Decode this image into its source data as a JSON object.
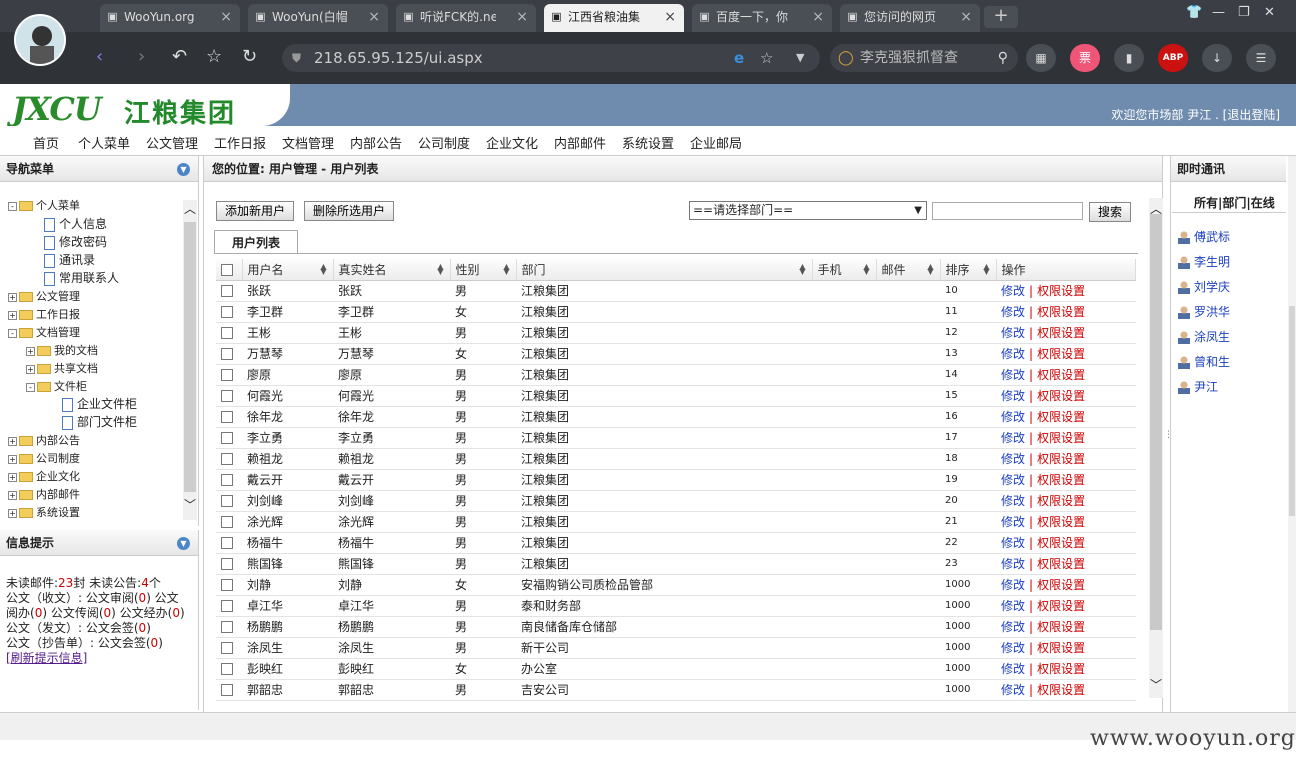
{
  "browser": {
    "tabs": [
      {
        "label": "WooYun.org",
        "active": false
      },
      {
        "label": "WooYun(白帽",
        "active": false
      },
      {
        "label": "听说FCK的.ne",
        "active": false
      },
      {
        "label": "江西省粮油集",
        "active": true
      },
      {
        "label": "百度一下，你",
        "active": false
      },
      {
        "label": "您访问的网页",
        "active": false
      }
    ],
    "url": "218.65.95.125/ui.aspx",
    "search_text": "李克强狠抓督查",
    "newtab_label": "+"
  },
  "header": {
    "logo_en": "JXCU",
    "logo_cn": "江粮集团",
    "welcome": "欢迎您市场部 尹江 . [退出登陆]"
  },
  "menu": [
    "首页",
    "个人菜单",
    "公文管理",
    "工作日报",
    "文档管理",
    "内部公告",
    "公司制度",
    "企业文化",
    "内部邮件",
    "系统设置",
    "企业邮局"
  ],
  "nav": {
    "title": "导航菜单",
    "items": [
      {
        "label": "个人菜单",
        "level": 0,
        "kind": "folder",
        "state": "-"
      },
      {
        "label": "个人信息",
        "level": 1,
        "kind": "doc"
      },
      {
        "label": "修改密码",
        "level": 1,
        "kind": "doc"
      },
      {
        "label": "通讯录",
        "level": 1,
        "kind": "doc"
      },
      {
        "label": "常用联系人",
        "level": 1,
        "kind": "doc"
      },
      {
        "label": "公文管理",
        "level": 0,
        "kind": "folder",
        "state": "+"
      },
      {
        "label": "工作日报",
        "level": 0,
        "kind": "folder",
        "state": "+"
      },
      {
        "label": "文档管理",
        "level": 0,
        "kind": "folder",
        "state": "-"
      },
      {
        "label": "我的文档",
        "level": 1,
        "kind": "folder",
        "state": "+"
      },
      {
        "label": "共享文档",
        "level": 1,
        "kind": "folder",
        "state": "+"
      },
      {
        "label": "文件柜",
        "level": 1,
        "kind": "folder",
        "state": "-"
      },
      {
        "label": "企业文件柜",
        "level": 2,
        "kind": "doc"
      },
      {
        "label": "部门文件柜",
        "level": 2,
        "kind": "doc"
      },
      {
        "label": "内部公告",
        "level": 0,
        "kind": "folder",
        "state": "+"
      },
      {
        "label": "公司制度",
        "level": 0,
        "kind": "folder",
        "state": "+"
      },
      {
        "label": "企业文化",
        "level": 0,
        "kind": "folder",
        "state": "+"
      },
      {
        "label": "内部邮件",
        "level": 0,
        "kind": "folder",
        "state": "+"
      },
      {
        "label": "系统设置",
        "level": 0,
        "kind": "folder",
        "state": "+"
      }
    ]
  },
  "info": {
    "title": "信息提示",
    "unread_mail_label": "未读邮件:",
    "unread_mail_count": "23",
    "unread_mail_unit": "封 未读公告:",
    "unread_notice_count": "4",
    "unread_notice_unit": "个",
    "line2a": "公文（收文）: 公文审阅(",
    "line2b": "0",
    "line2c": ") 公文",
    "line3a": "阅办(",
    "line3b": "0",
    "line3c": ") 公文传阅(",
    "line3d": "0",
    "line3e": ") 公文经办(",
    "line3f": "0",
    "line3g": ")",
    "line4a": "公文（发文）: 公文会签(",
    "line4b": "0",
    "line4c": ")",
    "line5a": "公文（抄告单）: 公文会签(",
    "line5b": "0",
    "line5c": ")",
    "refresh": "[刷新提示信息]"
  },
  "main": {
    "breadcrumb": "您的位置: 用户管理 - 用户列表",
    "add_button": "添加新用户",
    "delete_button": "删除所选用户",
    "dept_select": "==请选择部门==",
    "search_button": "搜索",
    "tab_label": "用户列表",
    "columns": [
      "用户名",
      "真实姓名",
      "性别",
      "部门",
      "手机",
      "邮件",
      "排序",
      "操作"
    ],
    "edit_label": "修改",
    "perm_label": "权限设置",
    "rows": [
      {
        "user": "张跃",
        "name": "张跃",
        "sex": "男",
        "dept": "江粮集团",
        "order": "10"
      },
      {
        "user": "李卫群",
        "name": "李卫群",
        "sex": "女",
        "dept": "江粮集团",
        "order": "11"
      },
      {
        "user": "王彬",
        "name": "王彬",
        "sex": "男",
        "dept": "江粮集团",
        "order": "12"
      },
      {
        "user": "万慧琴",
        "name": "万慧琴",
        "sex": "女",
        "dept": "江粮集团",
        "order": "13"
      },
      {
        "user": "廖原",
        "name": "廖原",
        "sex": "男",
        "dept": "江粮集团",
        "order": "14"
      },
      {
        "user": "何霞光",
        "name": "何霞光",
        "sex": "男",
        "dept": "江粮集团",
        "order": "15"
      },
      {
        "user": "徐年龙",
        "name": "徐年龙",
        "sex": "男",
        "dept": "江粮集团",
        "order": "16"
      },
      {
        "user": "李立勇",
        "name": "李立勇",
        "sex": "男",
        "dept": "江粮集团",
        "order": "17"
      },
      {
        "user": "赖祖龙",
        "name": "赖祖龙",
        "sex": "男",
        "dept": "江粮集团",
        "order": "18"
      },
      {
        "user": "戴云开",
        "name": "戴云开",
        "sex": "男",
        "dept": "江粮集团",
        "order": "19"
      },
      {
        "user": "刘剑峰",
        "name": "刘剑峰",
        "sex": "男",
        "dept": "江粮集团",
        "order": "20"
      },
      {
        "user": "涂光辉",
        "name": "涂光辉",
        "sex": "男",
        "dept": "江粮集团",
        "order": "21"
      },
      {
        "user": "杨福牛",
        "name": "杨福牛",
        "sex": "男",
        "dept": "江粮集团",
        "order": "22"
      },
      {
        "user": "熊国锋",
        "name": "熊国锋",
        "sex": "男",
        "dept": "江粮集团",
        "order": "23"
      },
      {
        "user": "刘静",
        "name": "刘静",
        "sex": "女",
        "dept": "安福购销公司质检品管部",
        "order": "1000"
      },
      {
        "user": "卓江华",
        "name": "卓江华",
        "sex": "男",
        "dept": "泰和财务部",
        "order": "1000"
      },
      {
        "user": "杨鹏鹏",
        "name": "杨鹏鹏",
        "sex": "男",
        "dept": "南良储备库仓储部",
        "order": "1000"
      },
      {
        "user": "涂凤生",
        "name": "涂凤生",
        "sex": "男",
        "dept": "新干公司",
        "order": "1000"
      },
      {
        "user": "彭映红",
        "name": "彭映红",
        "sex": "女",
        "dept": "办公室",
        "order": "1000"
      },
      {
        "user": "郭韶忠",
        "name": "郭韶忠",
        "sex": "男",
        "dept": "吉安公司",
        "order": "1000"
      }
    ]
  },
  "im": {
    "title": "即时通讯",
    "tabs": "所有|部门|在线",
    "users": [
      "傅武标",
      "李生明",
      "刘学庆",
      "罗洪华",
      "涂凤生",
      "曾和生",
      "尹江"
    ]
  },
  "watermark": "www.wooyun.org"
}
